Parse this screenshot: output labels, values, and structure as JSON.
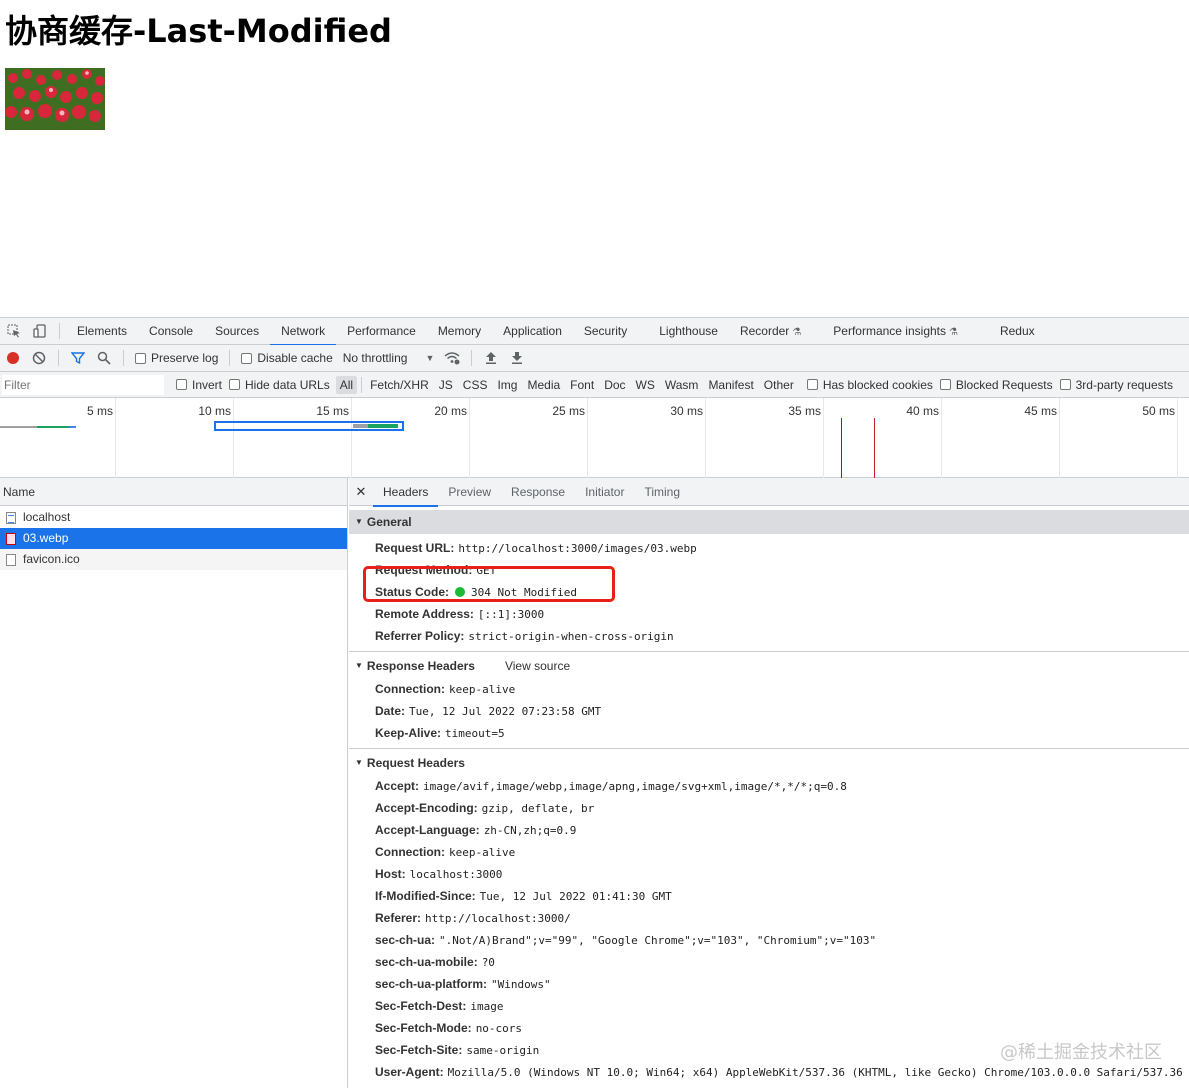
{
  "page": {
    "title": "协商缓存-Last-Modified"
  },
  "devtools": {
    "tabs": [
      "Elements",
      "Console",
      "Sources",
      "Network",
      "Performance",
      "Memory",
      "Application",
      "Security",
      "Lighthouse",
      "Recorder",
      "Performance insights",
      "Redux"
    ],
    "active_tab": "Network",
    "toolbar": {
      "preserve_log": "Preserve log",
      "disable_cache": "Disable cache",
      "throttling": "No throttling"
    },
    "filterbar": {
      "placeholder": "Filter",
      "invert": "Invert",
      "hide_data_urls": "Hide data URLs",
      "types": [
        "All",
        "Fetch/XHR",
        "JS",
        "CSS",
        "Img",
        "Media",
        "Font",
        "Doc",
        "WS",
        "Wasm",
        "Manifest",
        "Other"
      ],
      "active_type": "All",
      "has_blocked_cookies": "Has blocked cookies",
      "blocked_requests": "Blocked Requests",
      "third_party": "3rd-party requests"
    },
    "overview": {
      "ticks": [
        "5 ms",
        "10 ms",
        "15 ms",
        "20 ms",
        "25 ms",
        "30 ms",
        "35 ms",
        "40 ms",
        "45 ms",
        "50 ms"
      ]
    },
    "request_list": {
      "header": "Name",
      "rows": [
        "localhost",
        "03.webp",
        "favicon.ico"
      ],
      "selected": "03.webp"
    },
    "details": {
      "tabs": [
        "Headers",
        "Preview",
        "Response",
        "Initiator",
        "Timing"
      ],
      "active_tab": "Headers",
      "general": {
        "title": "General",
        "request_url_key": "Request URL:",
        "request_url": "http://localhost:3000/images/03.webp",
        "request_method_key": "Request Method:",
        "request_method": "GET",
        "status_code_key": "Status Code:",
        "status_code": "304 Not Modified",
        "remote_address_key": "Remote Address:",
        "remote_address": "[::1]:3000",
        "referrer_policy_key": "Referrer Policy:",
        "referrer_policy": "strict-origin-when-cross-origin"
      },
      "response_headers": {
        "title": "Response Headers",
        "view_source": "View source",
        "items": [
          {
            "k": "Connection:",
            "v": "keep-alive"
          },
          {
            "k": "Date:",
            "v": "Tue, 12 Jul 2022 07:23:58 GMT"
          },
          {
            "k": "Keep-Alive:",
            "v": "timeout=5"
          }
        ]
      },
      "request_headers": {
        "title": "Request Headers",
        "items": [
          {
            "k": "Accept:",
            "v": "image/avif,image/webp,image/apng,image/svg+xml,image/*,*/*;q=0.8"
          },
          {
            "k": "Accept-Encoding:",
            "v": "gzip, deflate, br"
          },
          {
            "k": "Accept-Language:",
            "v": "zh-CN,zh;q=0.9"
          },
          {
            "k": "Connection:",
            "v": "keep-alive"
          },
          {
            "k": "Host:",
            "v": "localhost:3000"
          },
          {
            "k": "If-Modified-Since:",
            "v": "Tue, 12 Jul 2022 01:41:30 GMT"
          },
          {
            "k": "Referer:",
            "v": "http://localhost:3000/"
          },
          {
            "k": "sec-ch-ua:",
            "v": "\".Not/A)Brand\";v=\"99\", \"Google Chrome\";v=\"103\", \"Chromium\";v=\"103\""
          },
          {
            "k": "sec-ch-ua-mobile:",
            "v": "?0"
          },
          {
            "k": "sec-ch-ua-platform:",
            "v": "\"Windows\""
          },
          {
            "k": "Sec-Fetch-Dest:",
            "v": "image"
          },
          {
            "k": "Sec-Fetch-Mode:",
            "v": "no-cors"
          },
          {
            "k": "Sec-Fetch-Site:",
            "v": "same-origin"
          },
          {
            "k": "User-Agent:",
            "v": "Mozilla/5.0 (Windows NT 10.0; Win64; x64) AppleWebKit/537.36 (KHTML, like Gecko) Chrome/103.0.0.0 Safari/537.36"
          }
        ]
      }
    }
  },
  "watermark": "@稀土掘金技术社区",
  "colors": {
    "accent": "#1a73e8",
    "highlight": "#e8201a",
    "status_ok": "#1bb934"
  }
}
